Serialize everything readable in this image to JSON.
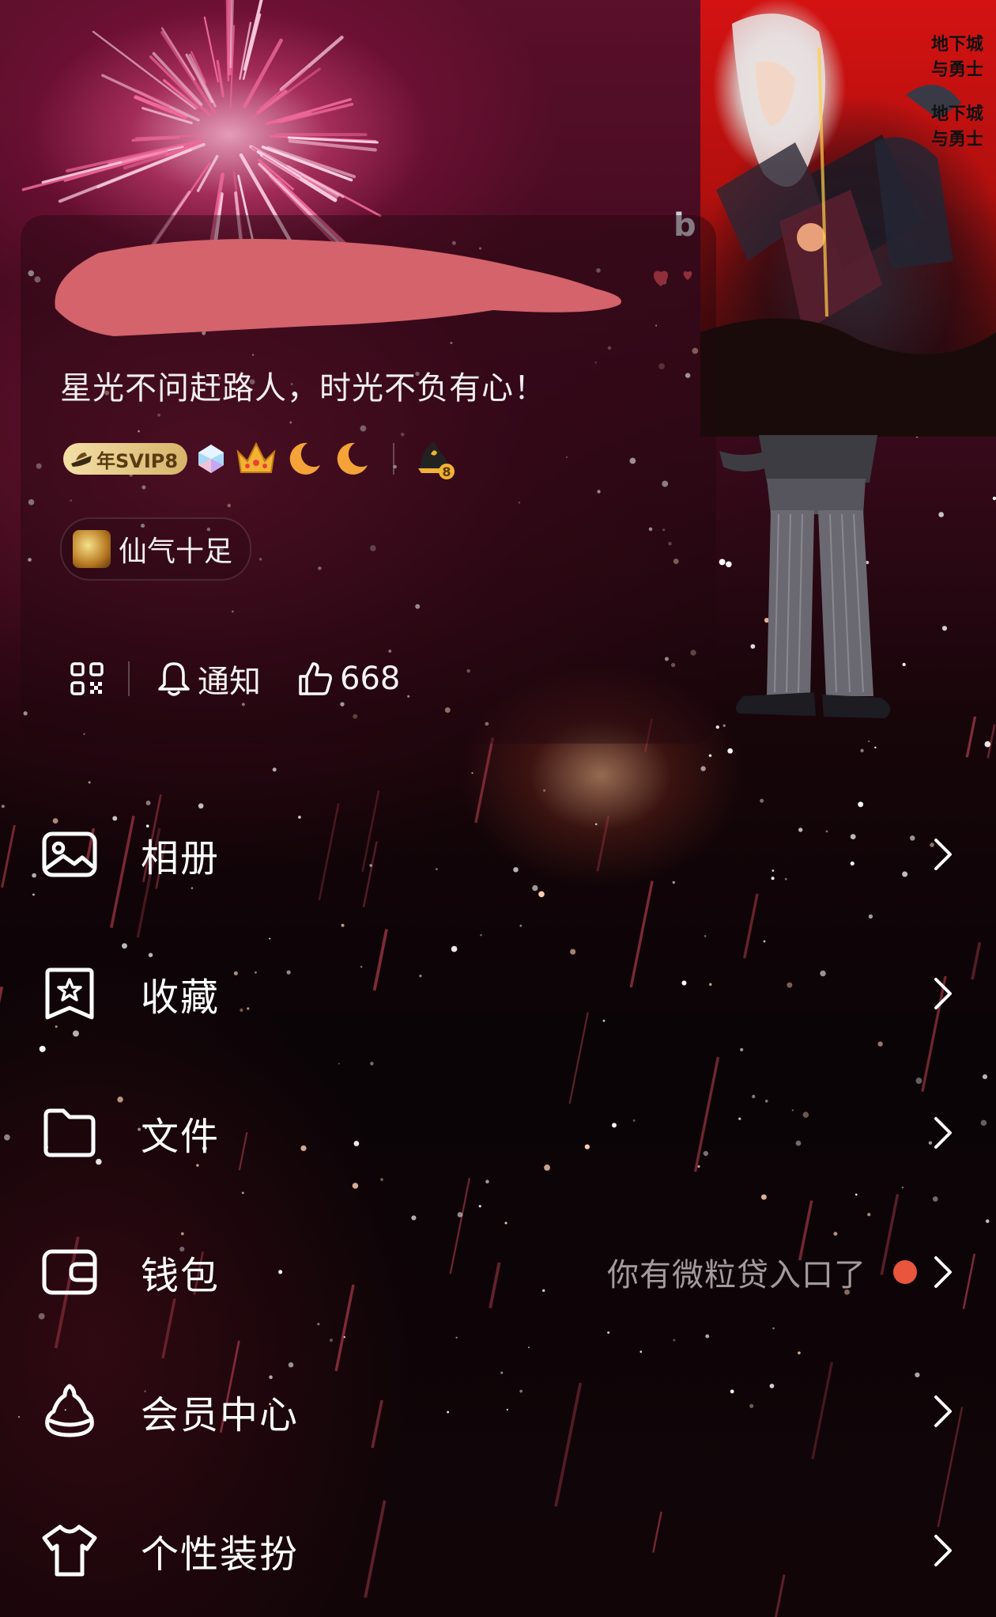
{
  "profile": {
    "signature": "星光不问赶路人，时光不负有心！",
    "svip_label": "年SVIP8",
    "level_badge_number": "8",
    "tag_label": "仙气十足"
  },
  "actions": {
    "notify_label": "通知",
    "likes_count": "668"
  },
  "banner": {
    "logo_text": "地下城与勇士"
  },
  "menu": {
    "items": [
      {
        "label": "相册",
        "icon": "photo-icon"
      },
      {
        "label": "收藏",
        "icon": "bookmark-star-icon"
      },
      {
        "label": "文件",
        "icon": "folder-icon"
      },
      {
        "label": "钱包",
        "icon": "wallet-icon",
        "hint": "你有微粒贷入口了",
        "has_red_dot": true
      },
      {
        "label": "会员中心",
        "icon": "member-center-icon"
      },
      {
        "label": "个性装扮",
        "icon": "tshirt-icon"
      }
    ]
  },
  "colors": {
    "accent_red_dot": "#e9553d",
    "svip_gold": "#e8cb87",
    "redaction": "#d4636b"
  }
}
